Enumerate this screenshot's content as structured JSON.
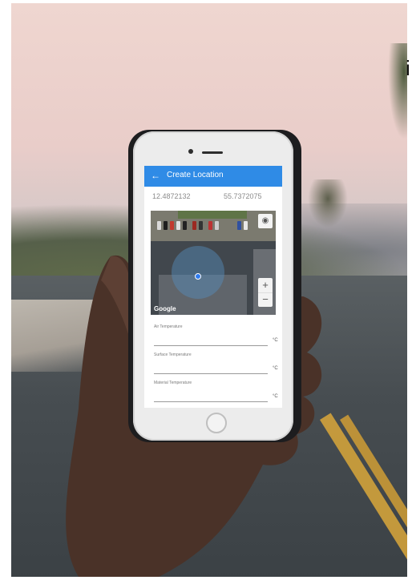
{
  "app": {
    "title": "Create Location",
    "back_icon": "←",
    "icon_names": {
      "back": "arrow-left-icon",
      "locate": "my-location-icon"
    }
  },
  "coordinates": {
    "latitude": "12.4872132",
    "longitude": "55.7372075"
  },
  "map": {
    "attribution": "Google",
    "locate_icon": "◉",
    "zoom_in": "+",
    "zoom_out": "−"
  },
  "fields": [
    {
      "label": "Air Temperature",
      "unit": "°C"
    },
    {
      "label": "Surface Temperature",
      "unit": "°C"
    },
    {
      "label": "Material Temperature",
      "unit": "°C"
    }
  ],
  "page": {
    "edge_glyph": "i"
  },
  "colors": {
    "appbar": "#2f8be6",
    "pin": "#2f7cf0"
  }
}
